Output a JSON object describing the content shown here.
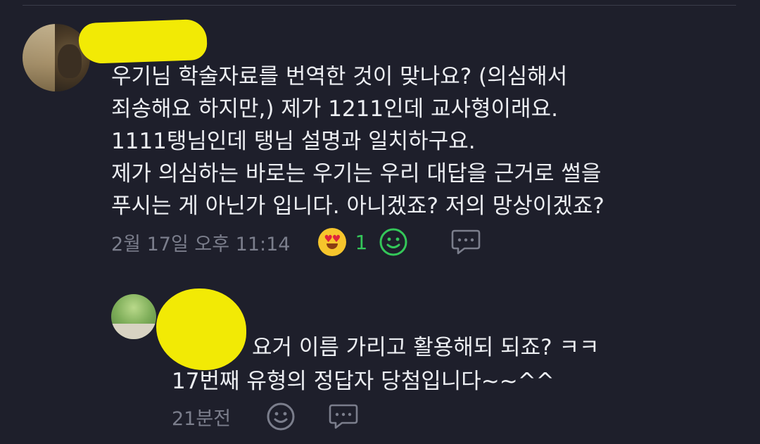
{
  "comment": {
    "author_name": "",
    "text": "우기님 학술자료를 번역한 것이 맞나요? (의심해서\n죄송해요 하지만,) 제가 1211인데 교사형이래요.\n1111탱님인데 탱님 설명과 일치하구요.\n제가 의심하는 바로는 우기는 우리 대답을 근거로 썰을\n푸시는 게 아닌가 입니다. 아니겠죠? 저의 망상이겠죠?",
    "timestamp": "2월 17일 오후 11:14",
    "reaction": {
      "icon": "heart-eyes-emoji-icon",
      "count": "1"
    },
    "add_reaction_icon": "smile-add-reaction-icon",
    "reply_icon": "comment-bubble-icon"
  },
  "reply": {
    "author_name": "",
    "text": "요거 이름 가리고 활용해되 되죠? ㅋㅋ\n17번째 유형의 정답자 당첨입니다~~^^",
    "timestamp": "21분전",
    "add_reaction_icon": "smile-add-reaction-icon",
    "reply_icon": "comment-bubble-icon"
  },
  "colors": {
    "background": "#1e1f2b",
    "text": "#eceef2",
    "muted": "#7b7e8c",
    "reaction_green": "#34c759",
    "redaction_yellow": "#f2ea05"
  }
}
